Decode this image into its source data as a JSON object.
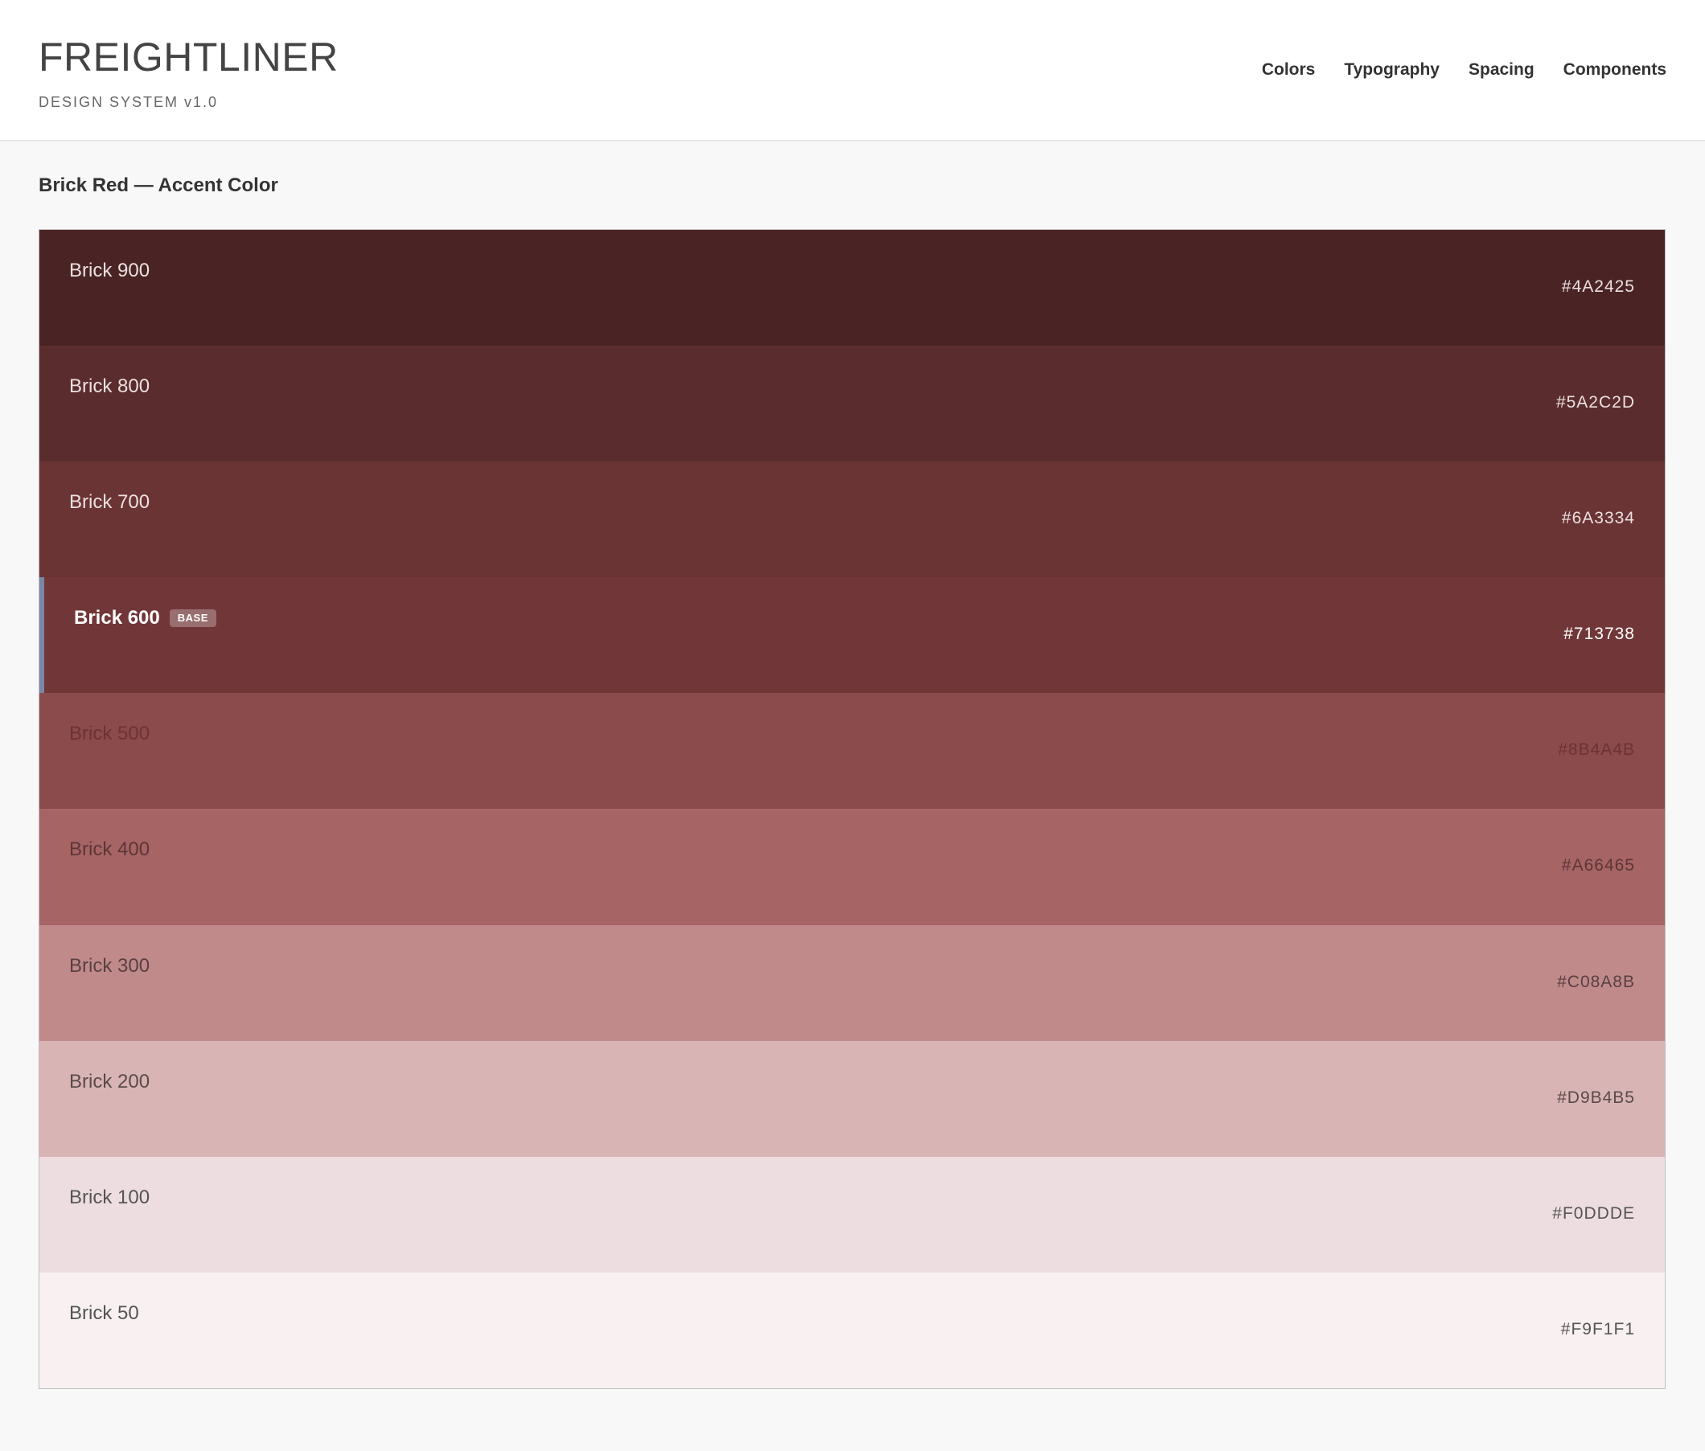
{
  "header": {
    "title": "FREIGHTLINER",
    "subtitle": "DESIGN SYSTEM v1.0"
  },
  "nav": {
    "items": [
      "Colors",
      "Typography",
      "Spacing",
      "Components"
    ]
  },
  "section": {
    "title": "Brick Red — Accent Color"
  },
  "swatches": [
    {
      "name": "Brick 900",
      "hex": "#4A2425",
      "color": "#4A2425",
      "text_color": "#ece0e0"
    },
    {
      "name": "Brick 800",
      "hex": "#5A2C2D",
      "color": "#5A2C2D",
      "text_color": "#ece0e0"
    },
    {
      "name": "Brick 700",
      "hex": "#6A3334",
      "color": "#6A3334",
      "text_color": "#ece0e0"
    },
    {
      "name": "Brick 600",
      "hex": "#713738",
      "color": "#713738",
      "text_color": "#ffffff",
      "badge": "BASE",
      "selected_border": "#7a86a8"
    },
    {
      "name": "Brick 500",
      "hex": "#8B4A4B",
      "color": "#8B4A4B",
      "text_color": "#6e3233"
    },
    {
      "name": "Brick 400",
      "hex": "#A66465",
      "color": "#A66465",
      "text_color": "#5e3535"
    },
    {
      "name": "Brick 300",
      "hex": "#C08A8B",
      "color": "#C08A8B",
      "text_color": "#5a4040"
    },
    {
      "name": "Brick 200",
      "hex": "#D9B4B5",
      "color": "#D9B4B5",
      "text_color": "#5a4a4a"
    },
    {
      "name": "Brick 100",
      "hex": "#F0DDDE",
      "color": "#EEDDE0",
      "text_color": "#555555"
    },
    {
      "name": "Brick 50",
      "hex": "#F9F1F1",
      "color": "#F9F0F1",
      "text_color": "#555555"
    }
  ]
}
